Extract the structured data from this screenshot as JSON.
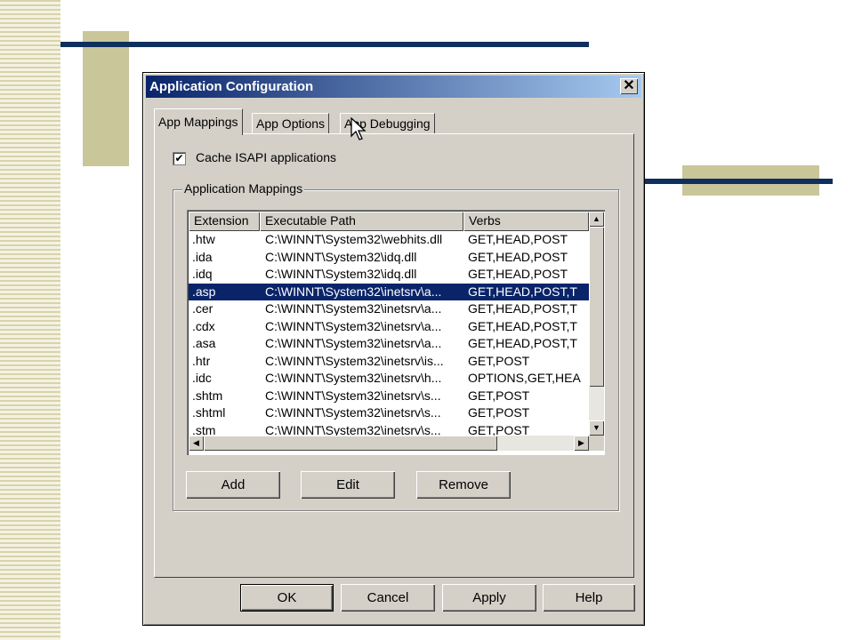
{
  "dialog": {
    "title": "Application Configuration",
    "close_glyph": "✕"
  },
  "tabs": [
    {
      "label": "App Mappings"
    },
    {
      "label": "App Options"
    },
    {
      "label": "App Debugging"
    }
  ],
  "cache_isapi": {
    "checked": true,
    "check_glyph": "✔",
    "label": "Cache ISAPI applications"
  },
  "mappings": {
    "group_label": "Application Mappings",
    "columns": [
      "Extension",
      "Executable Path",
      "Verbs"
    ],
    "rows": [
      {
        "ext": ".htw",
        "path": "C:\\WINNT\\System32\\webhits.dll",
        "verbs": "GET,HEAD,POST"
      },
      {
        "ext": ".ida",
        "path": "C:\\WINNT\\System32\\idq.dll",
        "verbs": "GET,HEAD,POST"
      },
      {
        "ext": ".idq",
        "path": "C:\\WINNT\\System32\\idq.dll",
        "verbs": "GET,HEAD,POST"
      },
      {
        "ext": ".asp",
        "path": "C:\\WINNT\\System32\\inetsrv\\a...",
        "verbs": "GET,HEAD,POST,T"
      },
      {
        "ext": ".cer",
        "path": "C:\\WINNT\\System32\\inetsrv\\a...",
        "verbs": "GET,HEAD,POST,T"
      },
      {
        "ext": ".cdx",
        "path": "C:\\WINNT\\System32\\inetsrv\\a...",
        "verbs": "GET,HEAD,POST,T"
      },
      {
        "ext": ".asa",
        "path": "C:\\WINNT\\System32\\inetsrv\\a...",
        "verbs": "GET,HEAD,POST,T"
      },
      {
        "ext": ".htr",
        "path": "C:\\WINNT\\System32\\inetsrv\\is...",
        "verbs": "GET,POST"
      },
      {
        "ext": ".idc",
        "path": "C:\\WINNT\\System32\\inetsrv\\h...",
        "verbs": "OPTIONS,GET,HEA"
      },
      {
        "ext": ".shtm",
        "path": "C:\\WINNT\\System32\\inetsrv\\s...",
        "verbs": "GET,POST"
      },
      {
        "ext": ".shtml",
        "path": "C:\\WINNT\\System32\\inetsrv\\s...",
        "verbs": "GET,POST"
      },
      {
        "ext": ".stm",
        "path": "C:\\WINNT\\System32\\inetsrv\\s...",
        "verbs": "GET,POST"
      }
    ],
    "selected_ext": ".asp",
    "scroll_arrows": {
      "up": "▲",
      "down": "▼",
      "left": "◀",
      "right": "▶"
    }
  },
  "actions": {
    "add": "Add",
    "edit": "Edit",
    "remove": "Remove"
  },
  "footer": {
    "ok": "OK",
    "cancel": "Cancel",
    "apply": "Apply",
    "help": "Help"
  },
  "colors": {
    "title_start": "#0a246a",
    "title_end": "#a6caf0",
    "dialog_face": "#d4d0c8",
    "selection": "#0a246a",
    "deco_navy": "#0f2f5c",
    "deco_khaki": "#c9c69a"
  }
}
